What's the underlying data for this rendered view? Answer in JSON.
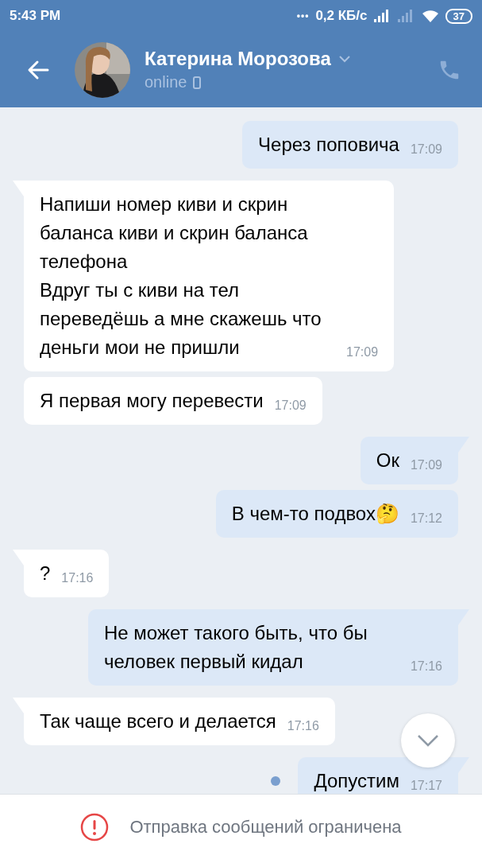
{
  "status_bar": {
    "time": "5:43 PM",
    "dots": "•••",
    "speed": "0,2 КБ/с",
    "battery": "37"
  },
  "header": {
    "name": "Катерина Морозова",
    "status": "online"
  },
  "messages": [
    {
      "kind": "outgoing",
      "text": "Через поповича",
      "time": "17:09",
      "tail": false,
      "unread": false
    },
    {
      "kind": "incoming",
      "text": "Напиши номер киви и скрин баланса киви и скрин баланса телефона\nВдруг ты с киви на тел переведёшь а мне скажешь что деньги мои не пришли",
      "time": "17:09",
      "tail": true,
      "unread": false
    },
    {
      "kind": "incoming",
      "text": "Я первая могу перевести",
      "time": "17:09",
      "tail": false,
      "unread": false
    },
    {
      "kind": "outgoing",
      "text": "Ок",
      "time": "17:09",
      "tail": true,
      "unread": false
    },
    {
      "kind": "outgoing",
      "text": "В чем-то подвох🤔",
      "time": "17:12",
      "tail": false,
      "unread": false
    },
    {
      "kind": "incoming",
      "text": "?",
      "time": "17:16",
      "tail": true,
      "unread": false
    },
    {
      "kind": "outgoing",
      "text": "Не может такого быть, что бы человек первый кидал",
      "time": "17:16",
      "tail": true,
      "unread": false
    },
    {
      "kind": "incoming",
      "text": "Так чаще всего и делается",
      "time": "17:16",
      "tail": true,
      "unread": false
    },
    {
      "kind": "outgoing",
      "text": "Допустим",
      "time": "17:17",
      "tail": true,
      "unread": true
    }
  ],
  "notice": {
    "text": "Отправка сообщений ограничена"
  }
}
